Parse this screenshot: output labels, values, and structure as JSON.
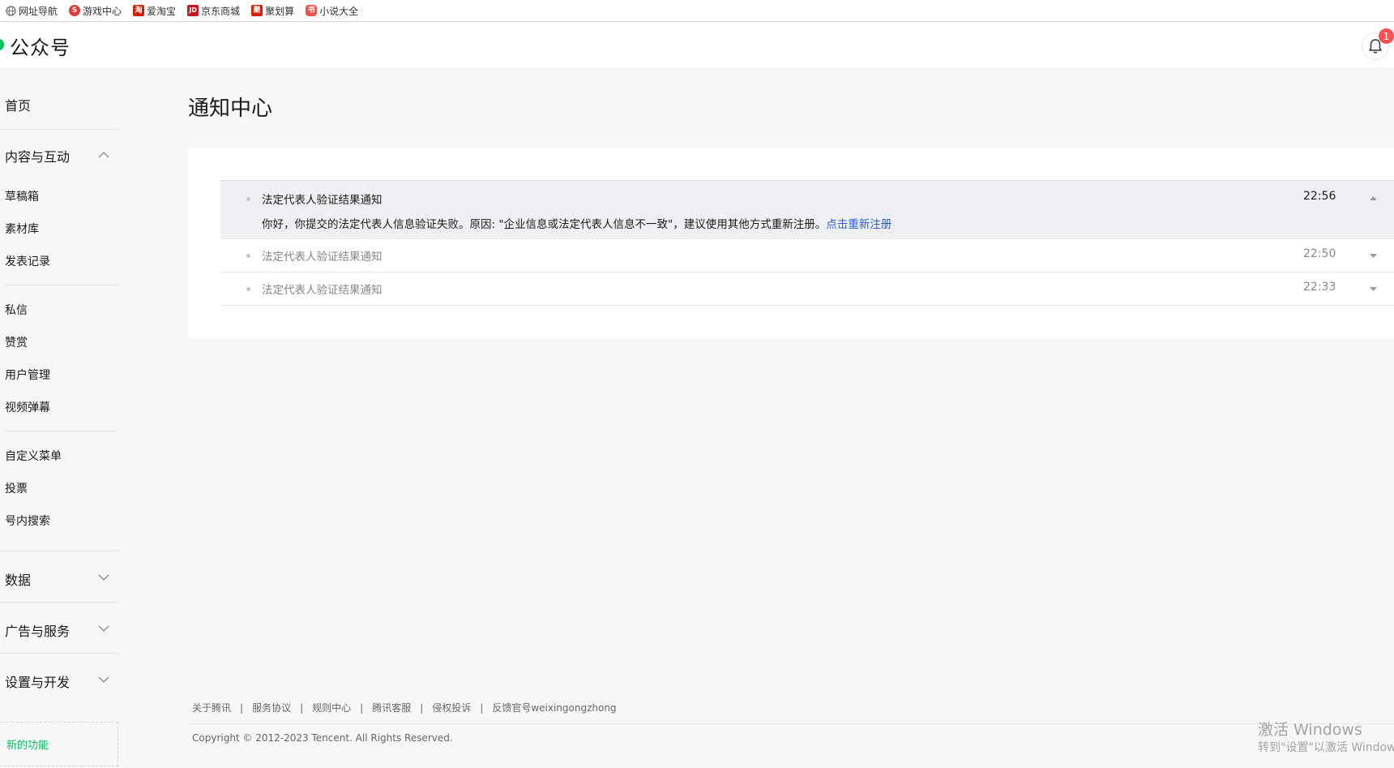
{
  "bookmarks": [
    {
      "label": "网址导航",
      "icon": "globe-icon",
      "color": "#666666",
      "glyph": ""
    },
    {
      "label": "游戏中心",
      "icon": "game-icon",
      "color": "#e53935",
      "glyph": "S"
    },
    {
      "label": "爱淘宝",
      "icon": "taobao-icon",
      "color": "#d81e06",
      "glyph": "淘"
    },
    {
      "label": "京东商城",
      "icon": "jd-icon",
      "color": "#c8161d",
      "glyph": "JD"
    },
    {
      "label": "聚划算",
      "icon": "juhuasuan-icon",
      "color": "#d81e06",
      "glyph": "聚"
    },
    {
      "label": "小说大全",
      "icon": "novel-icon",
      "color": "#ef5350",
      "glyph": "书"
    }
  ],
  "header": {
    "brand": "公众号",
    "notification_count": "1",
    "accent_color": "#07c160"
  },
  "sidebar": {
    "home": "首页",
    "content_group": "内容与互动",
    "content_items": [
      "草稿箱",
      "素材库",
      "发表记录"
    ],
    "interaction_items": [
      "私信",
      "赞赏",
      "用户管理",
      "视频弹幕"
    ],
    "feature_items": [
      "自定义菜单",
      "投票",
      "号内搜索"
    ],
    "data_group": "数据",
    "ads_group": "广告与服务",
    "settings_group": "设置与开发",
    "new_feature": "新的功能"
  },
  "main": {
    "title": "通知中心",
    "notifications": [
      {
        "title": "法定代表人验证结果通知",
        "time": "22:56",
        "expanded": true,
        "body": "你好，你提交的法定代表人信息验证失败。原因: \"企业信息或法定代表人信息不一致\"，建议使用其他方式重新注册。",
        "link": "点击重新注册"
      },
      {
        "title": "法定代表人验证结果通知",
        "time": "22:50",
        "expanded": false
      },
      {
        "title": "法定代表人验证结果通知",
        "time": "22:33",
        "expanded": false
      }
    ]
  },
  "footer": {
    "links": [
      "关于腾讯",
      "服务协议",
      "规则中心",
      "腾讯客服",
      "侵权投诉",
      "反馈官号weixingongzhong"
    ],
    "separator": "|",
    "copyright": "Copyright © 2012-2023 Tencent. All Rights Reserved."
  },
  "watermark": {
    "line1": "激活 Windows",
    "line2": "转到\"设置\"以激活 Windows。"
  }
}
